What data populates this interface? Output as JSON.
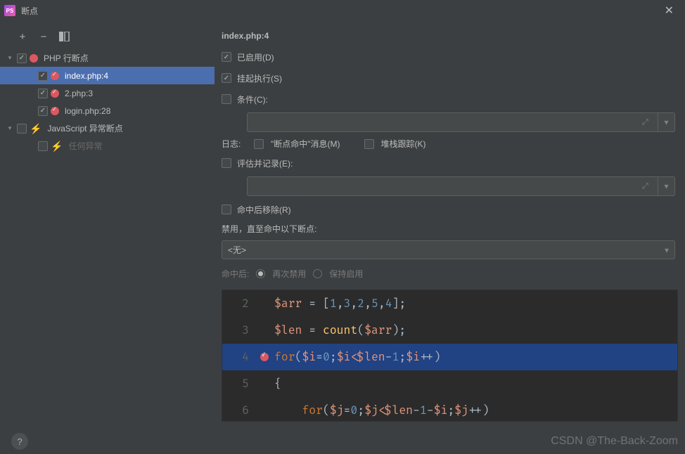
{
  "window": {
    "title": "断点",
    "app_icon_text": "PS"
  },
  "toolbar": {
    "add": "+",
    "remove": "−",
    "group": "⧉"
  },
  "tree": {
    "group1": {
      "label": "PHP 行断点",
      "checked": true
    },
    "item1": {
      "label": "index.php:4",
      "checked": true
    },
    "item2": {
      "label": "2.php:3",
      "checked": true
    },
    "item3": {
      "label": "login.php:28",
      "checked": true
    },
    "group2": {
      "label": "JavaScript 异常断点",
      "checked": false
    },
    "item4": {
      "label": "任何异常",
      "checked": false
    }
  },
  "details": {
    "title": "index.php:4",
    "enabled": {
      "label": "已启用(D)",
      "checked": true
    },
    "suspend": {
      "label": "挂起执行(S)",
      "checked": true
    },
    "condition": {
      "label": "条件(C):",
      "checked": false,
      "value": ""
    },
    "log_label": "日志:",
    "log_hit": {
      "label": "\"断点命中\"消息(M)",
      "checked": false
    },
    "stack": {
      "label": "堆栈跟踪(K)",
      "checked": false
    },
    "evaluate": {
      "label": "评估并记录(E):",
      "checked": false,
      "value": ""
    },
    "remove_after": {
      "label": "命中后移除(R)",
      "checked": false
    },
    "disable_until_label": "禁用，直至命中以下断点:",
    "disable_until_value": "<无>",
    "after_hit_label": "命中后:",
    "radio_disable": "再次禁用",
    "radio_keep": "保持启用"
  },
  "code": {
    "lines": [
      {
        "n": "2"
      },
      {
        "n": "3"
      },
      {
        "n": "4"
      },
      {
        "n": "5"
      },
      {
        "n": "6"
      }
    ]
  },
  "footer": {
    "help": "?",
    "watermark": "CSDN @The-Back-Zoom"
  }
}
